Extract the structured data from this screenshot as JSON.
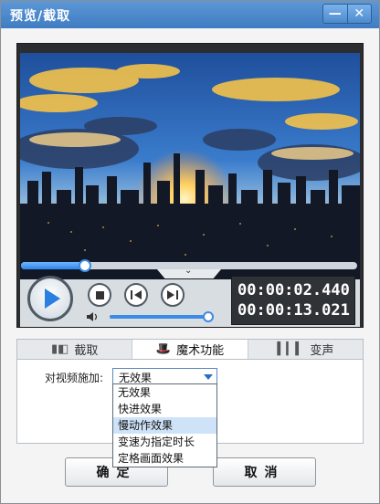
{
  "window": {
    "title": "预览/截取",
    "minimize_glyph": "—",
    "close_glyph": "✕"
  },
  "player": {
    "current_time": "00:00:02.440",
    "total_time": "00:00:13.021",
    "progress_fraction": 0.19,
    "volume_fraction": 1.0,
    "collapse_glyph": "⌄"
  },
  "tabs": [
    {
      "label": "截取",
      "icon": "film-clip-icon",
      "active": false
    },
    {
      "label": "魔术功能",
      "icon": "magic-hat-icon",
      "active": true
    },
    {
      "label": "变声",
      "icon": "audio-wave-icon",
      "active": false
    }
  ],
  "magic": {
    "apply_label": "对视频施加:",
    "selected": "无效果",
    "options": [
      "无效果",
      "快进效果",
      "慢动作效果",
      "变速为指定时长",
      "定格画面效果"
    ],
    "highlighted_index": 2
  },
  "buttons": {
    "ok": "确定",
    "cancel": "取消"
  },
  "colors": {
    "accent": "#3b8ae6",
    "titlebar": "#4a88cc",
    "highlight": "#cfe3f8"
  }
}
